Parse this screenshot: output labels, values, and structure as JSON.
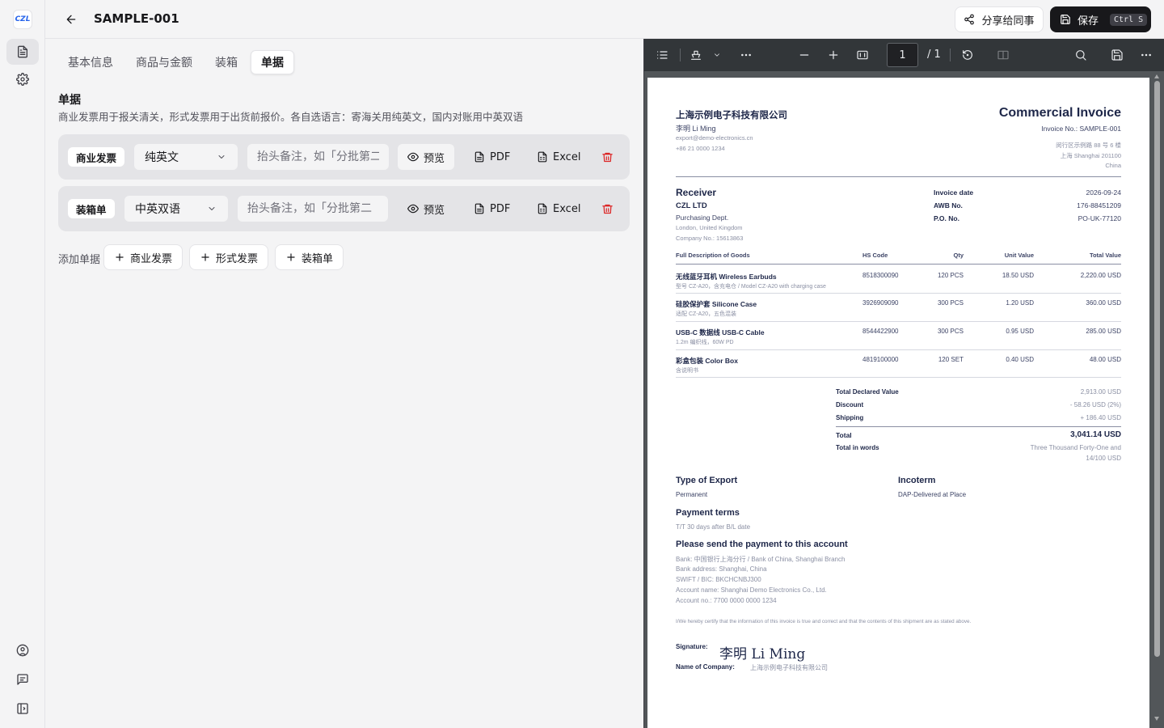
{
  "app": {
    "logo_text": "CZL"
  },
  "header": {
    "title": "SAMPLE-001",
    "share_label": "分享给同事",
    "save_label": "保存",
    "save_shortcut": "Ctrl S"
  },
  "tabs": [
    {
      "label": "基本信息"
    },
    {
      "label": "商品与金额"
    },
    {
      "label": "装箱"
    },
    {
      "label": "单据"
    }
  ],
  "active_tab": "单据",
  "section": {
    "title": "单据",
    "description": "商业发票用于报关清关，形式发票用于出货前报价。各自选语言：寄海关用纯英文，国内对账用中英双语"
  },
  "documents": [
    {
      "type": "商业发票",
      "language": "纯英文",
      "note_placeholder": "抬头备注，如「分批第二",
      "preview": "预览",
      "pdf": "PDF",
      "excel": "Excel"
    },
    {
      "type": "装箱单",
      "language": "中英双语",
      "note_placeholder": "抬头备注，如「分批第二",
      "preview": "预览",
      "pdf": "PDF",
      "excel": "Excel"
    }
  ],
  "add_docs": {
    "label": "添加单据",
    "buttons": [
      "商业发票",
      "形式发票",
      "装箱单"
    ]
  },
  "pdf_viewer": {
    "page": "1",
    "page_total": "/ 1"
  },
  "invoice": {
    "company": "上海示例电子科技有限公司",
    "contact_name": "李明 Li Ming",
    "email": "export@demo-electronics.cn",
    "phone": "+86 21 0000 1234",
    "title": "Commercial Invoice",
    "invoice_no": "Invoice No.: SAMPLE-001",
    "address_1": "闵行区示例路 88 号 6 楼",
    "address_2": "上海 Shanghai 201100",
    "address_3": "China",
    "receiver_heading": "Receiver",
    "receiver_name": "CZL LTD",
    "receiver_dept": "Purchasing Dept.",
    "receiver_location": "London, United Kingdom",
    "receiver_company_no": "Company No.: 15613863",
    "meta": [
      {
        "label": "Invoice date",
        "value": "2026-09-24"
      },
      {
        "label": "AWB No.",
        "value": "176-88451209"
      },
      {
        "label": "P.O. No.",
        "value": "PO-UK-77120"
      }
    ],
    "table_headers": {
      "desc": "Full Description of Goods",
      "hs": "HS Code",
      "qty": "Qty",
      "unit": "Unit Value",
      "total": "Total Value"
    },
    "items": [
      {
        "name": "无线蓝牙耳机 Wireless Earbuds",
        "sub": "型号 CZ-A20，含充电仓 / Model CZ-A20 with charging case",
        "hs": "8518300090",
        "qty": "120 PCS",
        "unit": "18.50 USD",
        "total": "2,220.00 USD"
      },
      {
        "name": "硅胶保护套 Silicone Case",
        "sub": "适配 CZ-A20，五色混装",
        "hs": "3926909090",
        "qty": "300 PCS",
        "unit": "1.20 USD",
        "total": "360.00 USD"
      },
      {
        "name": "USB-C 数据线 USB-C Cable",
        "sub": "1.2m 编织线，60W PD",
        "hs": "8544422900",
        "qty": "300 PCS",
        "unit": "0.95 USD",
        "total": "285.00 USD"
      },
      {
        "name": "彩盒包装 Color Box",
        "sub": "含说明书",
        "hs": "4819100000",
        "qty": "120 SET",
        "unit": "0.40 USD",
        "total": "48.00 USD"
      }
    ],
    "totals": [
      {
        "label": "Total Declared Value",
        "value": "2,913.00 USD"
      },
      {
        "label": "Discount",
        "value": "- 58.26 USD (2%)"
      },
      {
        "label": "Shipping",
        "value": "+ 186.40 USD"
      }
    ],
    "total_label": "Total",
    "total_value": "3,041.14 USD",
    "words_label": "Total in words",
    "words_line1": "Three Thousand Forty-One and",
    "words_line2": "14/100 USD",
    "export_heading": "Type of Export",
    "export_value": "Permanent",
    "incoterm_heading": "Incoterm",
    "incoterm_value": "DAP-Delivered at Place",
    "payment_heading": "Payment terms",
    "payment_value": "T/T 30 days after B/L date",
    "account_heading": "Please send the payment to this account",
    "account_lines": [
      "Bank: 中国银行上海分行 / Bank of China, Shanghai Branch",
      "Bank address: Shanghai, China",
      "SWIFT / BIC: BKCHCNBJ300",
      "Account name: Shanghai Demo Electronics Co., Ltd.",
      "Account no.: 7700 0000 0000 1234"
    ],
    "certify": "I/We hereby certify that the information of this invoice is true and correct and that the contents of this shipment are as stated above.",
    "signature_label": "Signature:",
    "signature_value": "李明 Li Ming",
    "company_label": "Name of Company:",
    "company_value": "上海示例电子科技有限公司"
  },
  "colors": {
    "accent": "#18181b",
    "danger": "#dc2626",
    "invoice_navy": "#1e2749",
    "pdf_bg": "#525659"
  }
}
